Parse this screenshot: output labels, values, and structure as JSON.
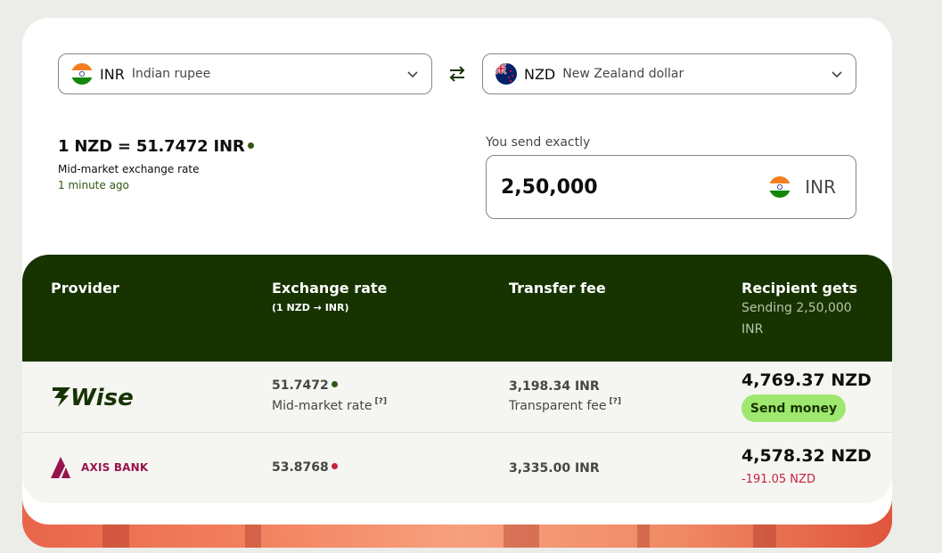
{
  "from_currency": {
    "code": "INR",
    "name": "Indian rupee",
    "flag": "india-flag-icon"
  },
  "to_currency": {
    "code": "NZD",
    "name": "New Zealand dollar",
    "flag": "new-zealand-flag-icon"
  },
  "rate": {
    "headline": "1 NZD = 51.7472 INR",
    "label": "Mid-market exchange rate",
    "updated": "1 minute ago"
  },
  "send": {
    "label": "You send exactly",
    "amount": "2,50,000",
    "currency": "INR"
  },
  "table": {
    "headers": {
      "provider": "Provider",
      "exchange_rate": "Exchange rate",
      "exchange_rate_sub": "(1 NZD → INR)",
      "transfer_fee": "Transfer fee",
      "recipient_gets": "Recipient gets",
      "recipient_sub": "Sending 2,50,000 INR"
    },
    "rows": [
      {
        "provider": "Wise",
        "rate": "51.7472",
        "rate_note": "Mid-market rate",
        "rate_note_help": "[?]",
        "fee": "3,198.34 INR",
        "fee_note": "Transparent fee",
        "fee_note_help": "[?]",
        "recipient": "4,769.37 NZD",
        "cta": "Send money"
      },
      {
        "provider": "AXIS BANK",
        "rate": "53.8768",
        "fee": "3,335.00 INR",
        "recipient": "4,578.32 NZD",
        "difference": "-191.05 NZD"
      }
    ]
  },
  "colors": {
    "brand_green": "#163300",
    "accent_green": "#9fe870",
    "negative": "#c8223e",
    "axis": "#97144d"
  }
}
